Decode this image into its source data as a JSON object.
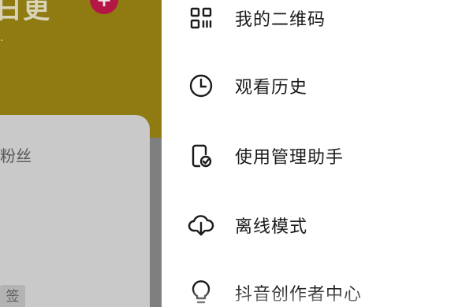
{
  "profile": {
    "name_fragment": "日更",
    "add_label": "+",
    "subtitle_fragment": "·",
    "fans_label": "粉丝",
    "tag_label": "签"
  },
  "menu": {
    "items": [
      {
        "label": "我的二维码",
        "icon": "qr-code-icon"
      },
      {
        "label": "观看历史",
        "icon": "clock-icon"
      },
      {
        "label": "使用管理助手",
        "icon": "phone-check-icon"
      },
      {
        "label": "离线模式",
        "icon": "cloud-download-icon"
      },
      {
        "label": "抖音创作者中心",
        "icon": "lightbulb-icon"
      }
    ]
  },
  "colors": {
    "header_bg": "#8f7b12",
    "add_button": "#b41646",
    "dim_card": "#c9c9c9",
    "menu_text": "#1a1a1a",
    "icon_stroke": "#1a1a1a"
  }
}
